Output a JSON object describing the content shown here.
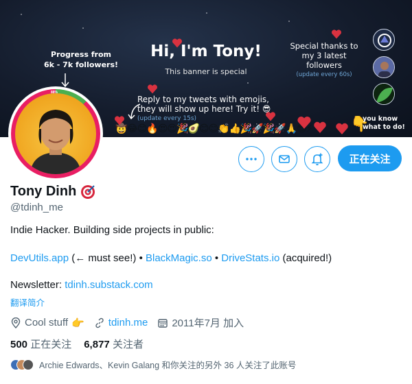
{
  "banner": {
    "progress_line1": "Progress from",
    "progress_line2": "6k - 7k followers!",
    "progress_percent": "88%",
    "title": "Hi, I'm Tony!",
    "subtitle": "This banner is special",
    "reply_line1": "Reply to my tweets with emojis,",
    "reply_line2": "they will show up here! Try it! 😎",
    "reply_note": "(update every 15s)",
    "thanks_line1": "Special thanks to",
    "thanks_line2": "my 3 latest followers",
    "thanks_note": "(update every 60s)",
    "youknow_line1": "you know",
    "youknow_line2": "what to do!",
    "emojis": "🤠😂😊🔥😍😍🎉🥑😊😊👏👍🎉🚀🎉🚀🙏😎⚡"
  },
  "actions": {
    "more_label": "更多",
    "message_label": "消息",
    "notify_label": "通知",
    "follow_label": "正在关注"
  },
  "profile": {
    "name": "Tony Dinh",
    "handle": "@tdinh_me",
    "bio_line1": "Indie Hacker. Building side projects in public:",
    "link_devutils": "DevUtils.app",
    "text_must_see": " (← must see!)  • ",
    "link_blackmagic": "BlackMagic.so",
    "text_bullet": " • ",
    "link_drivestats": "DriveStats.io",
    "text_acquired": " (acquired!)",
    "newsletter_label": "Newsletter: ",
    "link_newsletter": "tdinh.substack.com",
    "translate": "翻译简介",
    "location": "Cool stuff",
    "location_emoji": "👉",
    "website": "tdinh.me",
    "joined": "2011年7月 加入"
  },
  "stats": {
    "following_count": "500",
    "following_label": "正在关注",
    "followers_count": "6,877",
    "followers_label": "关注者"
  },
  "followed_by": "Archie Edwards、Kevin Galang 和你关注的另外 36 人关注了此账号",
  "colors": {
    "accent": "#1d9bf0",
    "ring_pink": "#e91e63",
    "ring_green": "#4caf50"
  }
}
